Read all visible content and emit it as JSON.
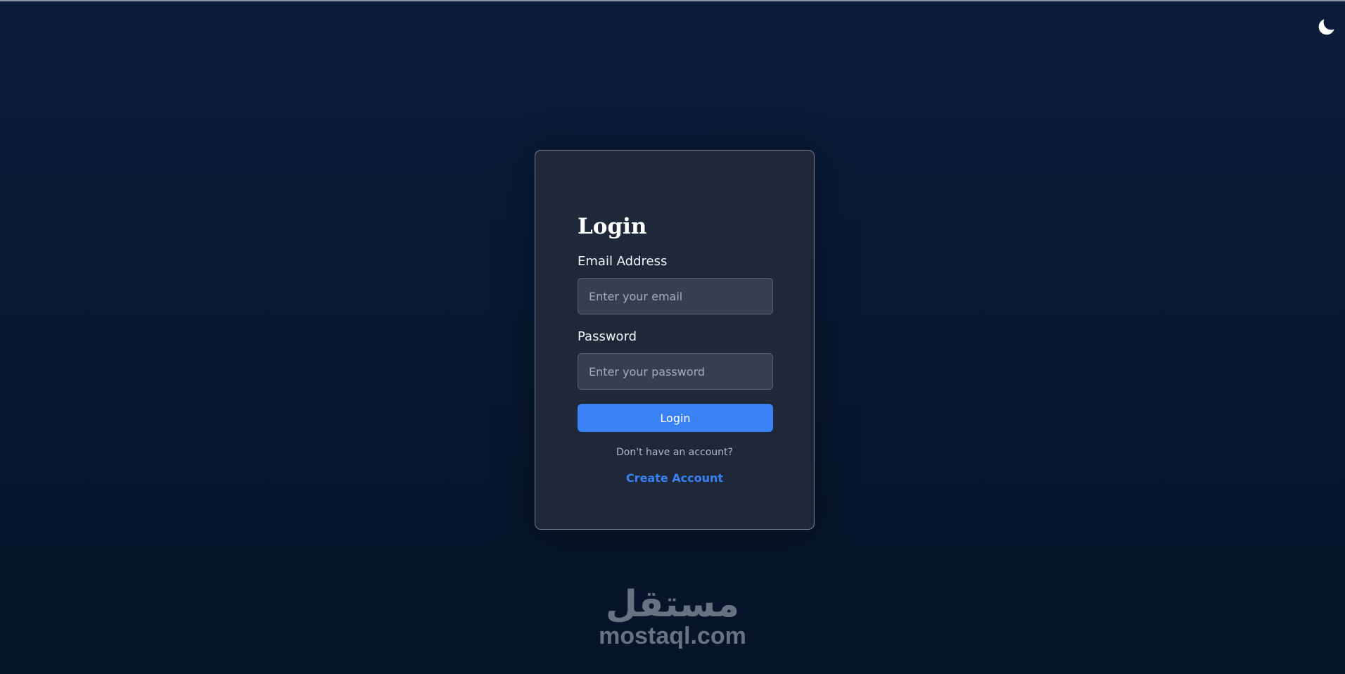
{
  "theme_toggle": {
    "icon": "moon-icon"
  },
  "login_card": {
    "title": "Login",
    "email": {
      "label": "Email Address",
      "placeholder": "Enter your email",
      "value": ""
    },
    "password": {
      "label": "Password",
      "placeholder": "Enter your password",
      "value": ""
    },
    "submit_label": "Login",
    "signup_prompt": "Don't have an account?",
    "signup_link": "Create Account"
  },
  "watermark": {
    "arabic": "مستقل",
    "latin": "mostaql.com"
  },
  "colors": {
    "background": "#0a1c3a",
    "card": "#1f2839",
    "input": "#363f51",
    "accent": "#3b82f6"
  }
}
